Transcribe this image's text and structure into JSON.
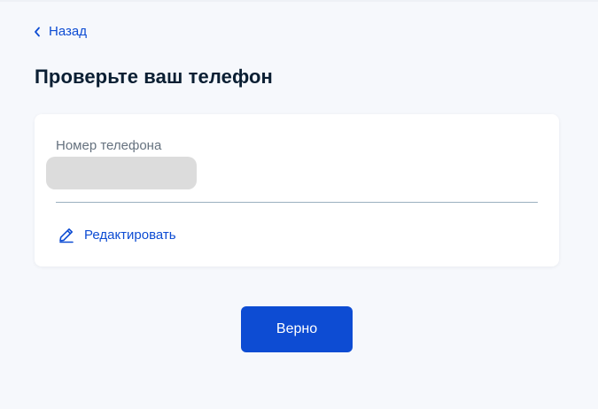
{
  "nav": {
    "back_label": "Назад"
  },
  "page": {
    "title": "Проверьте ваш телефон"
  },
  "phone_card": {
    "field_label": "Номер телефона",
    "edit_label": "Редактировать"
  },
  "actions": {
    "confirm_label": "Верно"
  },
  "colors": {
    "accent": "#0d4cd3",
    "background": "#f6f8fc",
    "title_text": "#0b1f33",
    "label_text": "#66727f",
    "masked_value": "#dcdcdc"
  },
  "icons": {
    "back": "chevron-left-icon",
    "edit": "pencil-icon"
  }
}
